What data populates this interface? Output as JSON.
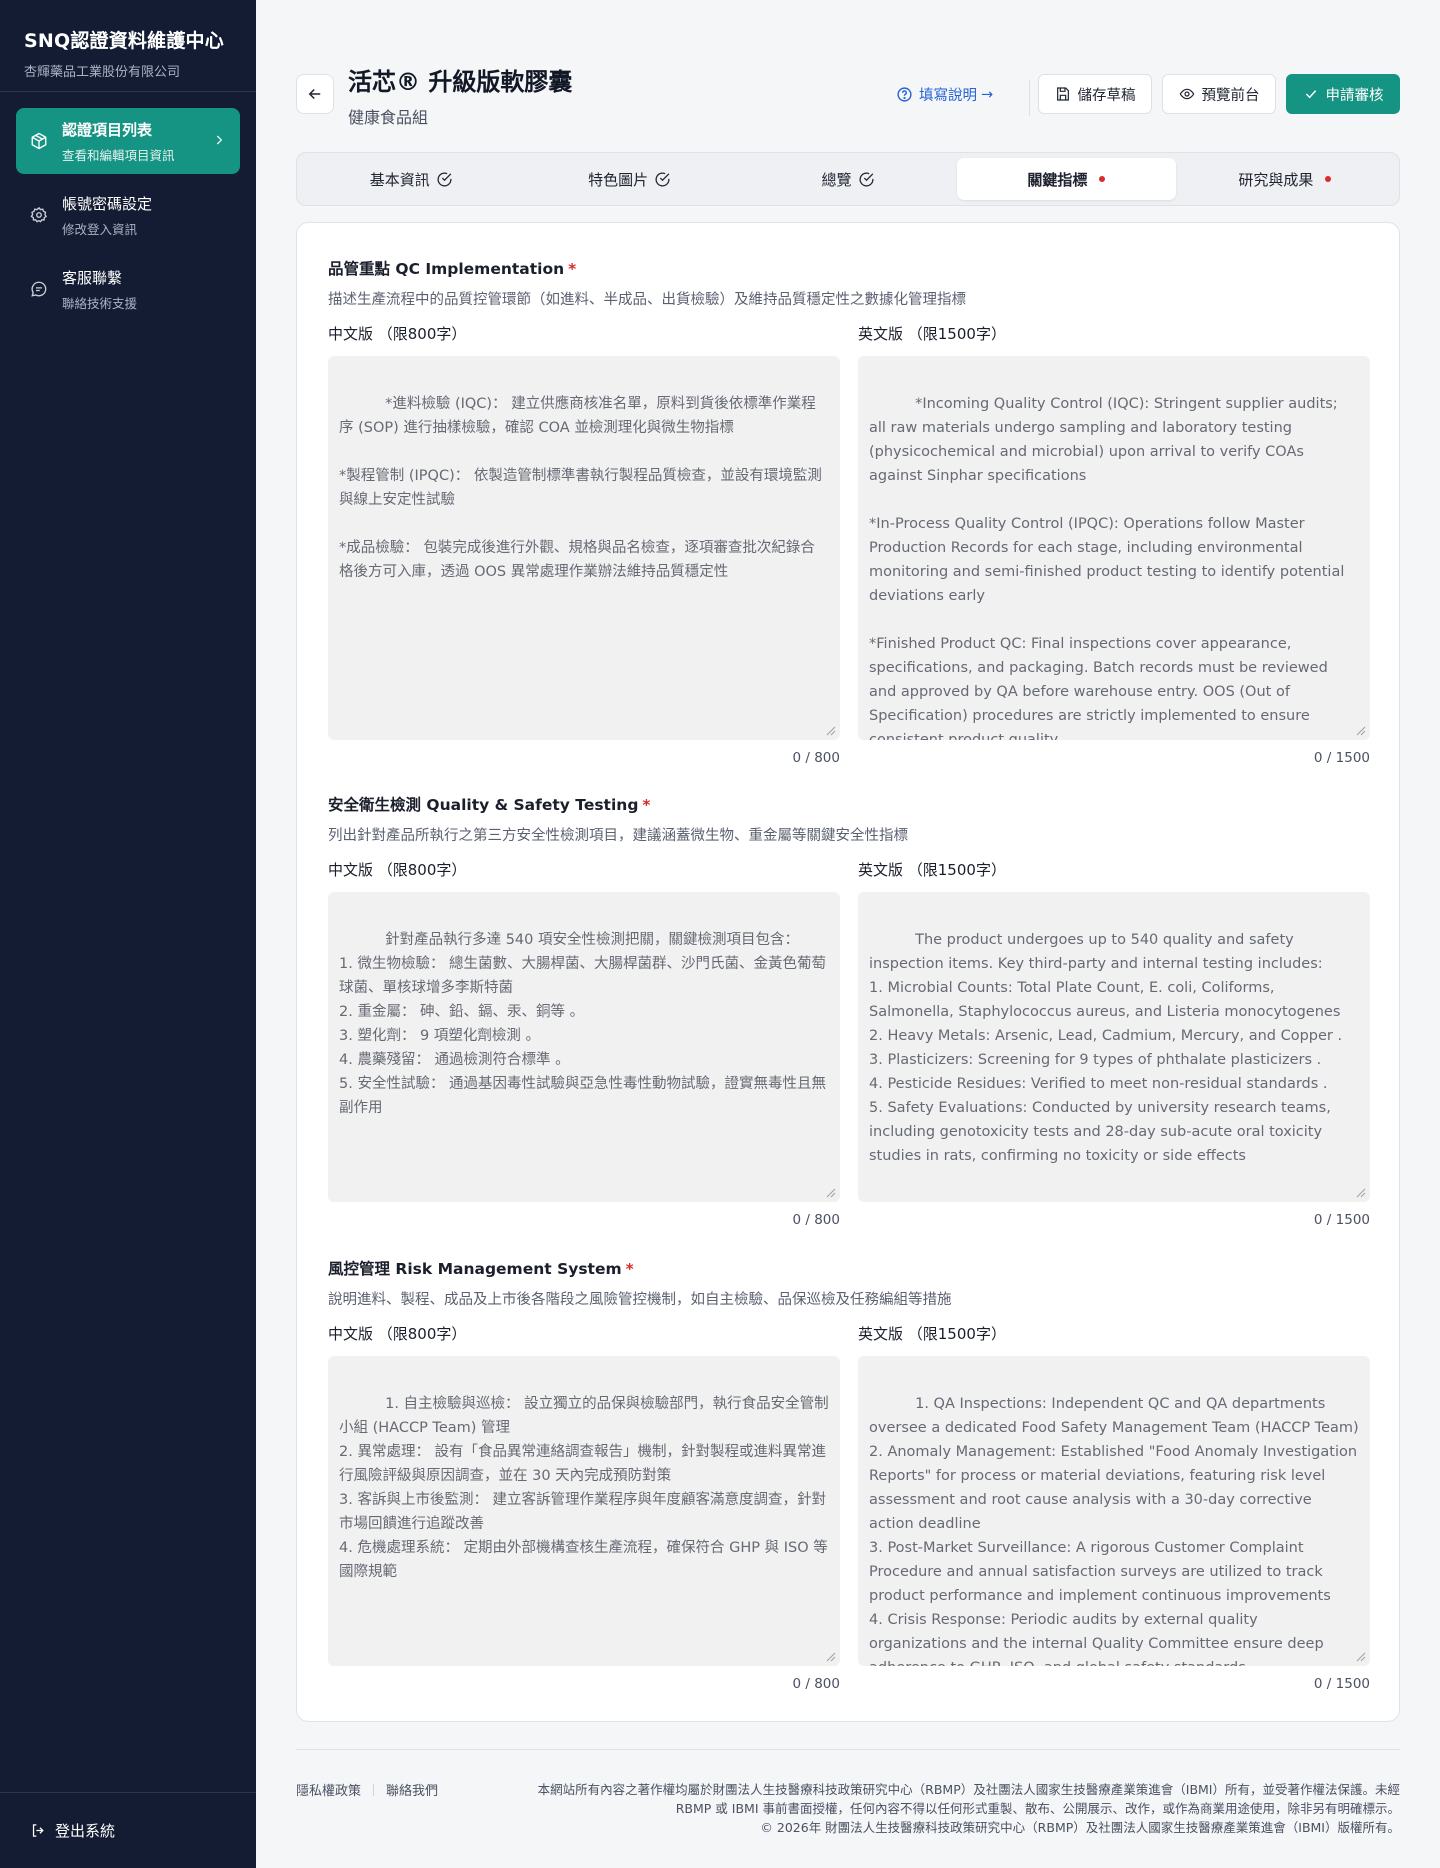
{
  "sidebar": {
    "brand_title": "SNQ認證資料維護中心",
    "brand_sub": "杏輝藥品工業股份有限公司",
    "items": [
      {
        "label": "認證項目列表",
        "sub": "查看和編輯項目資訊",
        "icon": "box-icon"
      },
      {
        "label": "帳號密碼設定",
        "sub": "修改登入資訊",
        "icon": "gear-icon"
      },
      {
        "label": "客服聯繫",
        "sub": "聯絡技術支援",
        "icon": "chat-icon"
      }
    ],
    "logout": "登出系統"
  },
  "header": {
    "title": "活芯® 升級版軟膠囊",
    "subtitle": "健康食品組",
    "help": "填寫說明",
    "help_arrow": "→",
    "save": "儲存草稿",
    "preview": "預覽前台",
    "submit": "申請審核"
  },
  "tabs": [
    {
      "label": "基本資訊",
      "status": "done"
    },
    {
      "label": "特色圖片",
      "status": "done"
    },
    {
      "label": "總覽",
      "status": "done"
    },
    {
      "label": "關鍵指標",
      "status": "required",
      "active": true
    },
    {
      "label": "研究與成果",
      "status": "required"
    }
  ],
  "sections": [
    {
      "title": "品管重點 QC Implementation",
      "required": "*",
      "desc": "描述生產流程中的品質控管環節（如進料、半成品、出貨檢驗）及維持品質穩定性之數據化管理指標",
      "zh_label": "中文版 （限800字）",
      "en_label": "英文版 （限1500字）",
      "zh_text": "*進料檢驗 (IQC)： 建立供應商核准名單，原料到貨後依標準作業程序 (SOP) 進行抽樣檢驗，確認 COA 並檢測理化與微生物指標\n\n*製程管制 (IPQC)： 依製造管制標準書執行製程品質檢查，並設有環境監測與線上安定性試驗\n\n*成品檢驗： 包裝完成後進行外觀、規格與品名檢查，逐項審查批次紀錄合格後方可入庫，透過 OOS 異常處理作業辦法維持品質穩定性",
      "en_text": "*Incoming Quality Control (IQC): Stringent supplier audits; all raw materials undergo sampling and laboratory testing (physicochemical and microbial) upon arrival to verify COAs against Sinphar specifications\n\n*In-Process Quality Control (IPQC): Operations follow Master Production Records for each stage, including environmental monitoring and semi-finished product testing to identify potential deviations early\n\n*Finished Product QC: Final inspections cover appearance, specifications, and packaging. Batch records must be reviewed and approved by QA before warehouse entry. OOS (Out of Specification) procedures are strictly implemented to ensure consistent product quality",
      "zh_count": "0 / 800",
      "en_count": "0 / 1500"
    },
    {
      "title": "安全衛生檢測 Quality & Safety Testing",
      "required": "*",
      "desc": "列出針對產品所執行之第三方安全性檢測項目，建議涵蓋微生物、重金屬等關鍵安全性指標",
      "zh_label": "中文版 （限800字）",
      "en_label": "英文版 （限1500字）",
      "zh_text": "針對產品執行多達 540 項安全性檢測把關，關鍵檢測項目包含：\n1. 微生物檢驗： 總生菌數、大腸桿菌、大腸桿菌群、沙門氏菌、金黃色葡萄球菌、單核球增多李斯特菌\n2. 重金屬： 砷、鉛、鎘、汞、銅等 。\n3. 塑化劑： 9 項塑化劑檢測 。\n4. 農藥殘留： 通過檢測符合標準 。\n5. 安全性試驗： 通過基因毒性試驗與亞急性毒性動物試驗，證實無毒性且無副作用",
      "en_text": "The product undergoes up to 540 quality and safety inspection items. Key third-party and internal testing includes:\n1. Microbial Counts: Total Plate Count, E. coli, Coliforms, Salmonella, Staphylococcus aureus, and Listeria monocytogenes\n2. Heavy Metals: Arsenic, Lead, Cadmium, Mercury, and Copper .\n3. Plasticizers: Screening for 9 types of phthalate plasticizers .\n4. Pesticide Residues: Verified to meet non-residual standards .\n5. Safety Evaluations: Conducted by university research teams, including genotoxicity tests and 28-day sub-acute oral toxicity studies in rats, confirming no toxicity or side effects",
      "zh_count": "0 / 800",
      "en_count": "0 / 1500"
    },
    {
      "title": "風控管理 Risk Management System",
      "required": "*",
      "desc": "說明進料、製程、成品及上市後各階段之風險管控機制，如自主檢驗、品保巡檢及任務編組等措施",
      "zh_label": "中文版 （限800字）",
      "en_label": "英文版 （限1500字）",
      "zh_text": "1. 自主檢驗與巡檢： 設立獨立的品保與檢驗部門，執行食品安全管制小組 (HACCP Team) 管理\n2. 異常處理： 設有「食品異常連絡調查報告」機制，針對製程或進料異常進行風險評級與原因調查，並在 30 天內完成預防對策\n3. 客訴與上市後監測： 建立客訴管理作業程序與年度顧客滿意度調查，針對市場回饋進行追蹤改善\n4. 危機處理系統： 定期由外部機構查核生產流程，確保符合 GHP 與 ISO 等國際規範",
      "en_text": "1. QA Inspections: Independent QC and QA departments oversee a dedicated Food Safety Management Team (HACCP Team)\n2. Anomaly Management: Established \"Food Anomaly Investigation Reports\" for process or material deviations, featuring risk level assessment and root cause analysis with a 30-day corrective action deadline\n3. Post-Market Surveillance: A rigorous Customer Complaint Procedure and annual satisfaction surveys are utilized to track product performance and implement continuous improvements\n4. Crisis Response: Periodic audits by external quality organizations and the internal Quality Committee ensure deep adherence to GHP, ISO, and global safety standards",
      "zh_count": "0 / 800",
      "en_count": "0 / 1500"
    }
  ],
  "footer": {
    "privacy": "隱私權政策",
    "contact": "聯絡我們",
    "copy1": "本網站所有內容之著作權均屬於財團法人生技醫療科技政策研究中心（RBMP）及社團法人國家生技醫療產業策進會（IBMI）所有，並受著作權法保護。未經 RBMP 或 IBMI 事前書面授權，任何內容不得以任何形式重製、散布、公開展示、改作，或作為商業用途使用，除非另有明確標示。",
    "copy2": "© 2026年 財團法人生技醫療科技政策研究中心（RBMP）及社團法人國家生技醫療產業策進會（IBMI）版權所有。"
  },
  "colors": {
    "sidebar_bg": "#131c33",
    "accent": "#159383",
    "link": "#2563d6",
    "required": "#d92c2c"
  }
}
